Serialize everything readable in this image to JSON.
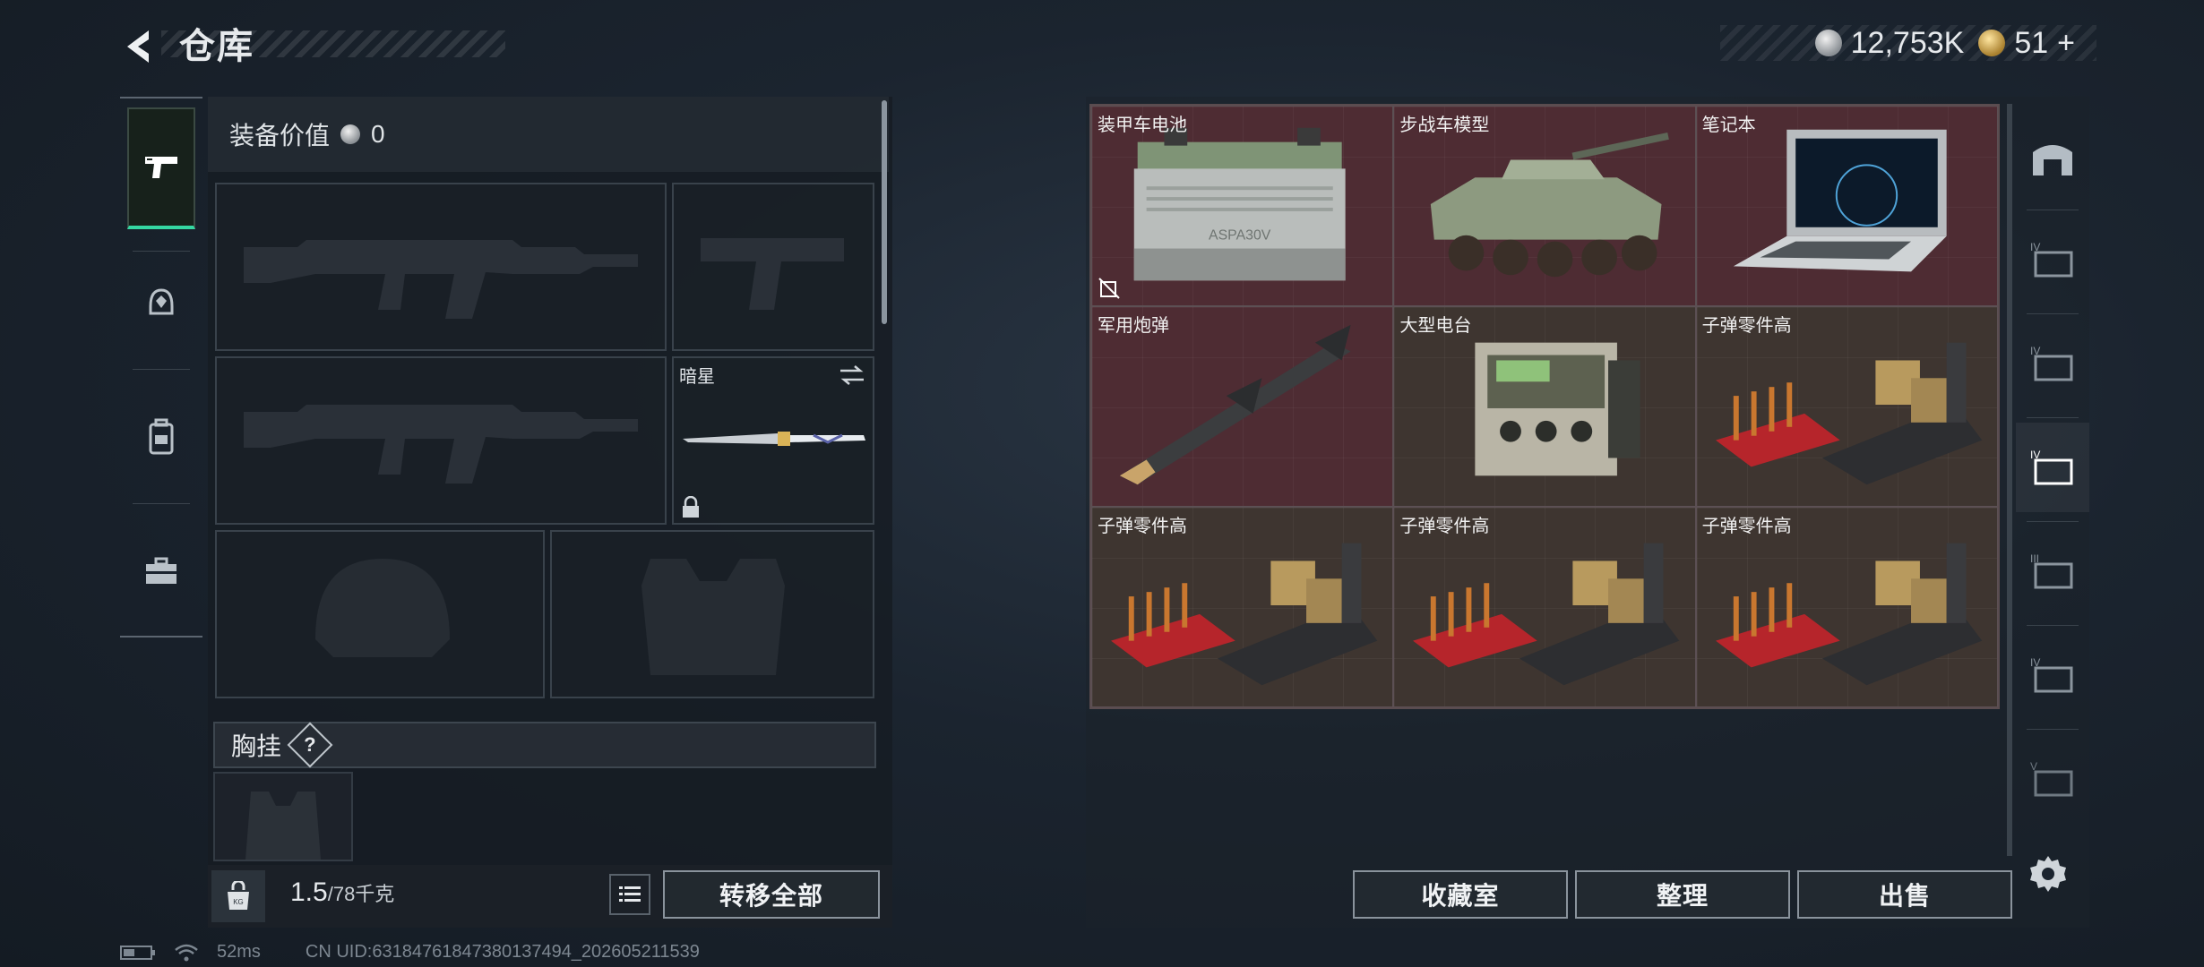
{
  "header": {
    "title": "仓库",
    "currency_silver": "12,753K",
    "currency_gold": "51",
    "gold_add": "+"
  },
  "left_nav": {
    "items": [
      {
        "name": "weapon",
        "icon": "pistol-icon",
        "active": true
      },
      {
        "name": "helmet",
        "icon": "helmet-icon",
        "active": false
      },
      {
        "name": "backpack",
        "icon": "backpack-icon",
        "active": false
      },
      {
        "name": "toolbox",
        "icon": "toolbox-icon",
        "active": false
      }
    ]
  },
  "equipment": {
    "value_label": "装备价值",
    "value": "0",
    "melee_slot_name": "暗星",
    "chest_rig_label": "胸挂",
    "help_symbol": "?"
  },
  "weight": {
    "current": "1.5",
    "max": "/78千克"
  },
  "buttons": {
    "transfer_all": "转移全部",
    "collection": "收藏室",
    "organize": "整理",
    "sell": "出售"
  },
  "storage_items": [
    {
      "label": "装甲车电池",
      "color": "red",
      "icon": "battery-icon"
    },
    {
      "label": "步战车模型",
      "color": "red",
      "icon": "ifv-model-icon"
    },
    {
      "label": "笔记本",
      "color": "red",
      "icon": "laptop-icon"
    },
    {
      "label": "军用炮弹",
      "color": "red",
      "icon": "missile-icon"
    },
    {
      "label": "大型电台",
      "color": "brown",
      "icon": "radio-icon"
    },
    {
      "label": "子弹零件高",
      "color": "brown",
      "icon": "ammo-parts-icon"
    },
    {
      "label": "子弹零件高",
      "color": "brown",
      "icon": "ammo-parts-icon"
    },
    {
      "label": "子弹零件高",
      "color": "brown",
      "icon": "ammo-parts-icon"
    },
    {
      "label": "子弹零件高",
      "color": "brown",
      "icon": "ammo-parts-icon"
    }
  ],
  "right_nav": {
    "items": [
      {
        "name": "vault",
        "level": ""
      },
      {
        "name": "storage",
        "level": "IV"
      },
      {
        "name": "storage",
        "level": "IV"
      },
      {
        "name": "storage",
        "level": "IV",
        "active": true
      },
      {
        "name": "storage",
        "level": "III"
      },
      {
        "name": "storage",
        "level": "IV"
      },
      {
        "name": "storage",
        "level": "V"
      }
    ]
  },
  "status": {
    "ping": "52ms",
    "uid": "CN UID:6318476184738013749​4_202605211539"
  },
  "colors": {
    "accent_green": "#35d7a2",
    "cell_red": "#4e2c33",
    "cell_brown": "#3e3530"
  }
}
